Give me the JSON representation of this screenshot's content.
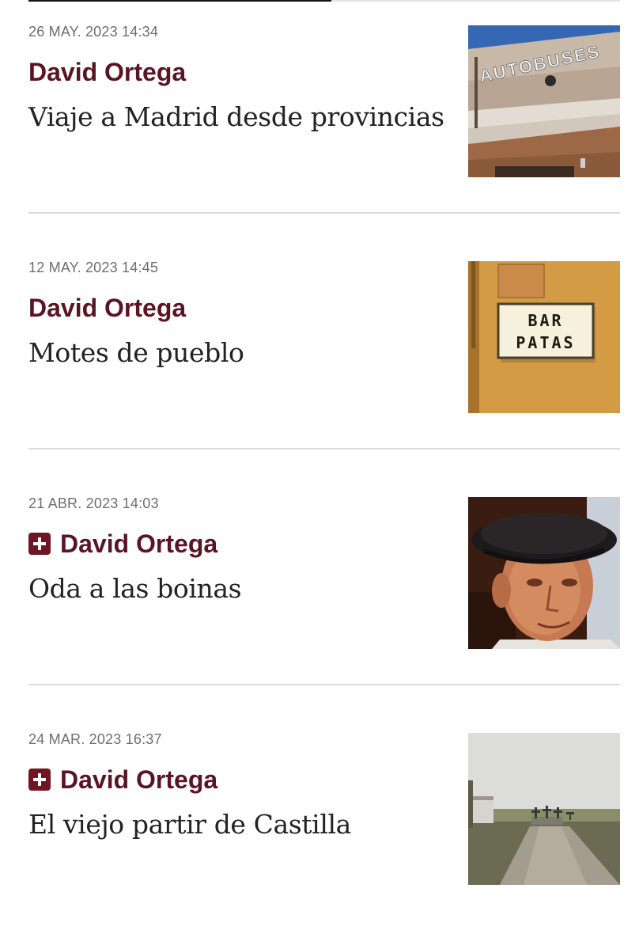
{
  "articles": [
    {
      "date": "26 MAY. 2023 14:34",
      "author": "David Ortega",
      "premium": false,
      "title": "Viaje a Madrid desde provincias",
      "image": {
        "icon": "bus-station-photo",
        "sign_text": "AUTOBUSES"
      }
    },
    {
      "date": "12 MAY. 2023 14:45",
      "author": "David Ortega",
      "premium": false,
      "title": "Motes de pueblo",
      "image": {
        "icon": "bar-sign-photo",
        "sign_line1": "BAR",
        "sign_line2": "PATAS"
      }
    },
    {
      "date": "21 ABR. 2023 14:03",
      "author": "David Ortega",
      "premium": true,
      "title": "Oda a las boinas",
      "image": {
        "icon": "old-man-beret-photo"
      }
    },
    {
      "date": "24 MAR. 2023 16:37",
      "author": "David Ortega",
      "premium": true,
      "title": "El viejo partir de Castilla",
      "image": {
        "icon": "country-road-crosses-photo"
      }
    }
  ],
  "colors": {
    "author": "#5a1423",
    "premium_badge": "#6f1622",
    "date": "#6e6e6e",
    "headline": "#222222",
    "divider": "#dcdcdc"
  }
}
